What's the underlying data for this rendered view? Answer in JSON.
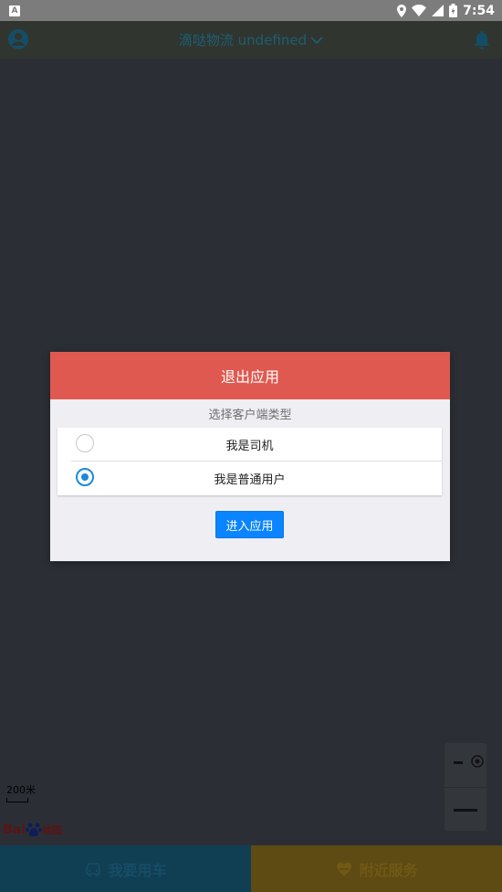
{
  "status_bar": {
    "time": "7:54",
    "app_icon_letter": "A"
  },
  "header": {
    "title": "滴哒物流 undefined"
  },
  "map": {
    "scale_label": "200米",
    "logo_text_left": "Bai",
    "logo_text_right": "地图"
  },
  "dialog": {
    "title": "退出应用",
    "subtitle": "选择客户端类型",
    "options": [
      {
        "label": "我是司机",
        "selected": false
      },
      {
        "label": "我是普通用户",
        "selected": true
      }
    ],
    "enter_button": "进入应用"
  },
  "bottom_tabs": [
    {
      "label": "我要用车",
      "icon": "car-icon"
    },
    {
      "label": "附近服务",
      "icon": "heart-hands-icon"
    }
  ],
  "colors": {
    "dialog_header": "#e05950",
    "accent": "#0a84ff",
    "radio_selected": "#1b8adb"
  }
}
